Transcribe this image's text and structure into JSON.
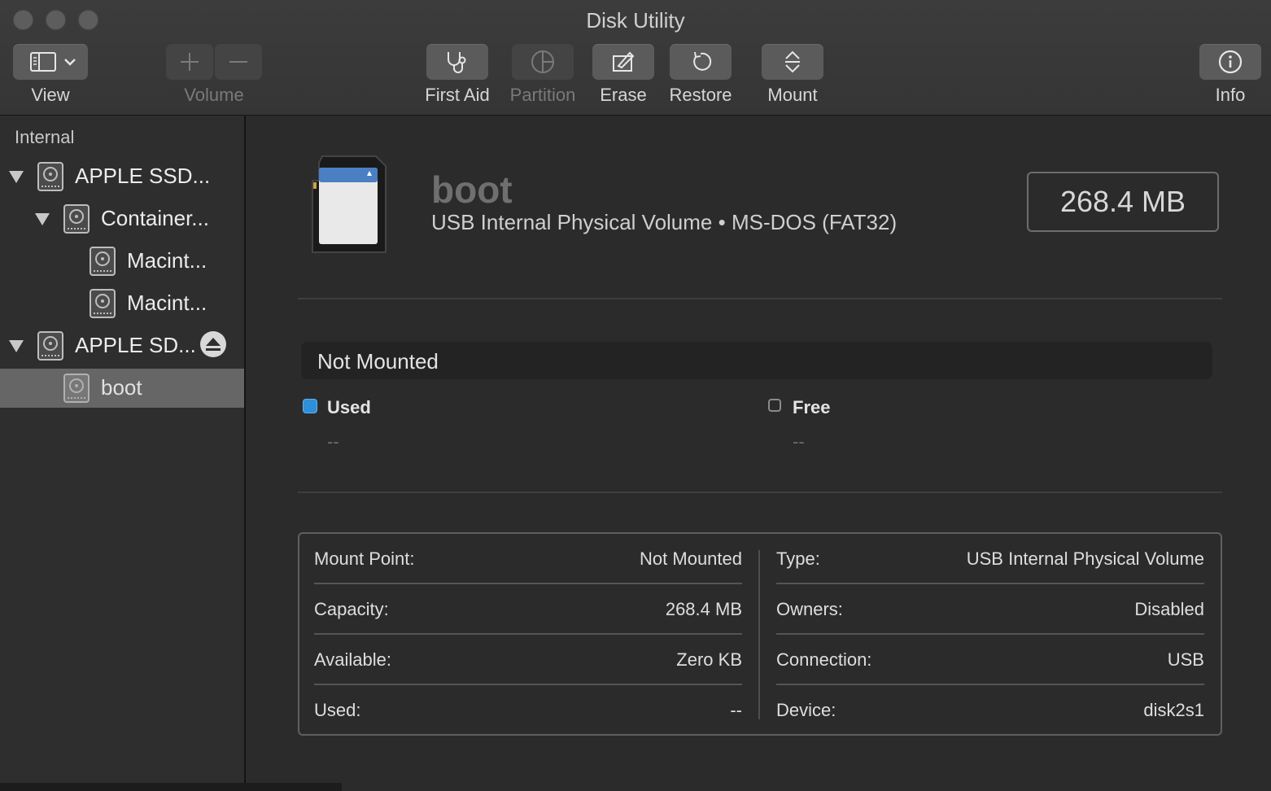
{
  "window": {
    "title": "Disk Utility"
  },
  "toolbar": {
    "view_label": "View",
    "volume_label": "Volume",
    "first_aid_label": "First Aid",
    "partition_label": "Partition",
    "erase_label": "Erase",
    "restore_label": "Restore",
    "mount_label": "Mount",
    "info_label": "Info"
  },
  "sidebar": {
    "section_title": "Internal",
    "items": [
      {
        "label": "APPLE SSD...",
        "level": 0,
        "expanded": true
      },
      {
        "label": "Container...",
        "level": 1,
        "expanded": true
      },
      {
        "label": "Macint...",
        "level": 2
      },
      {
        "label": "Macint...",
        "level": 2
      },
      {
        "label": "APPLE SD...",
        "level": 0,
        "expanded": true,
        "ejectable": true
      },
      {
        "label": "boot",
        "level": 1,
        "selected": true
      }
    ]
  },
  "volume": {
    "name": "boot",
    "subtitle": "USB Internal Physical Volume • MS-DOS (FAT32)",
    "size": "268.4 MB"
  },
  "usage": {
    "status": "Not Mounted",
    "used_label": "Used",
    "used_value": "--",
    "free_label": "Free",
    "free_value": "--",
    "used_color": "#2f8fd8"
  },
  "info": {
    "left": [
      {
        "key": "Mount Point:",
        "value": "Not Mounted"
      },
      {
        "key": "Capacity:",
        "value": "268.4 MB"
      },
      {
        "key": "Available:",
        "value": "Zero KB"
      },
      {
        "key": "Used:",
        "value": "--"
      }
    ],
    "right": [
      {
        "key": "Type:",
        "value": "USB Internal Physical Volume"
      },
      {
        "key": "Owners:",
        "value": "Disabled"
      },
      {
        "key": "Connection:",
        "value": "USB"
      },
      {
        "key": "Device:",
        "value": "disk2s1"
      }
    ]
  }
}
